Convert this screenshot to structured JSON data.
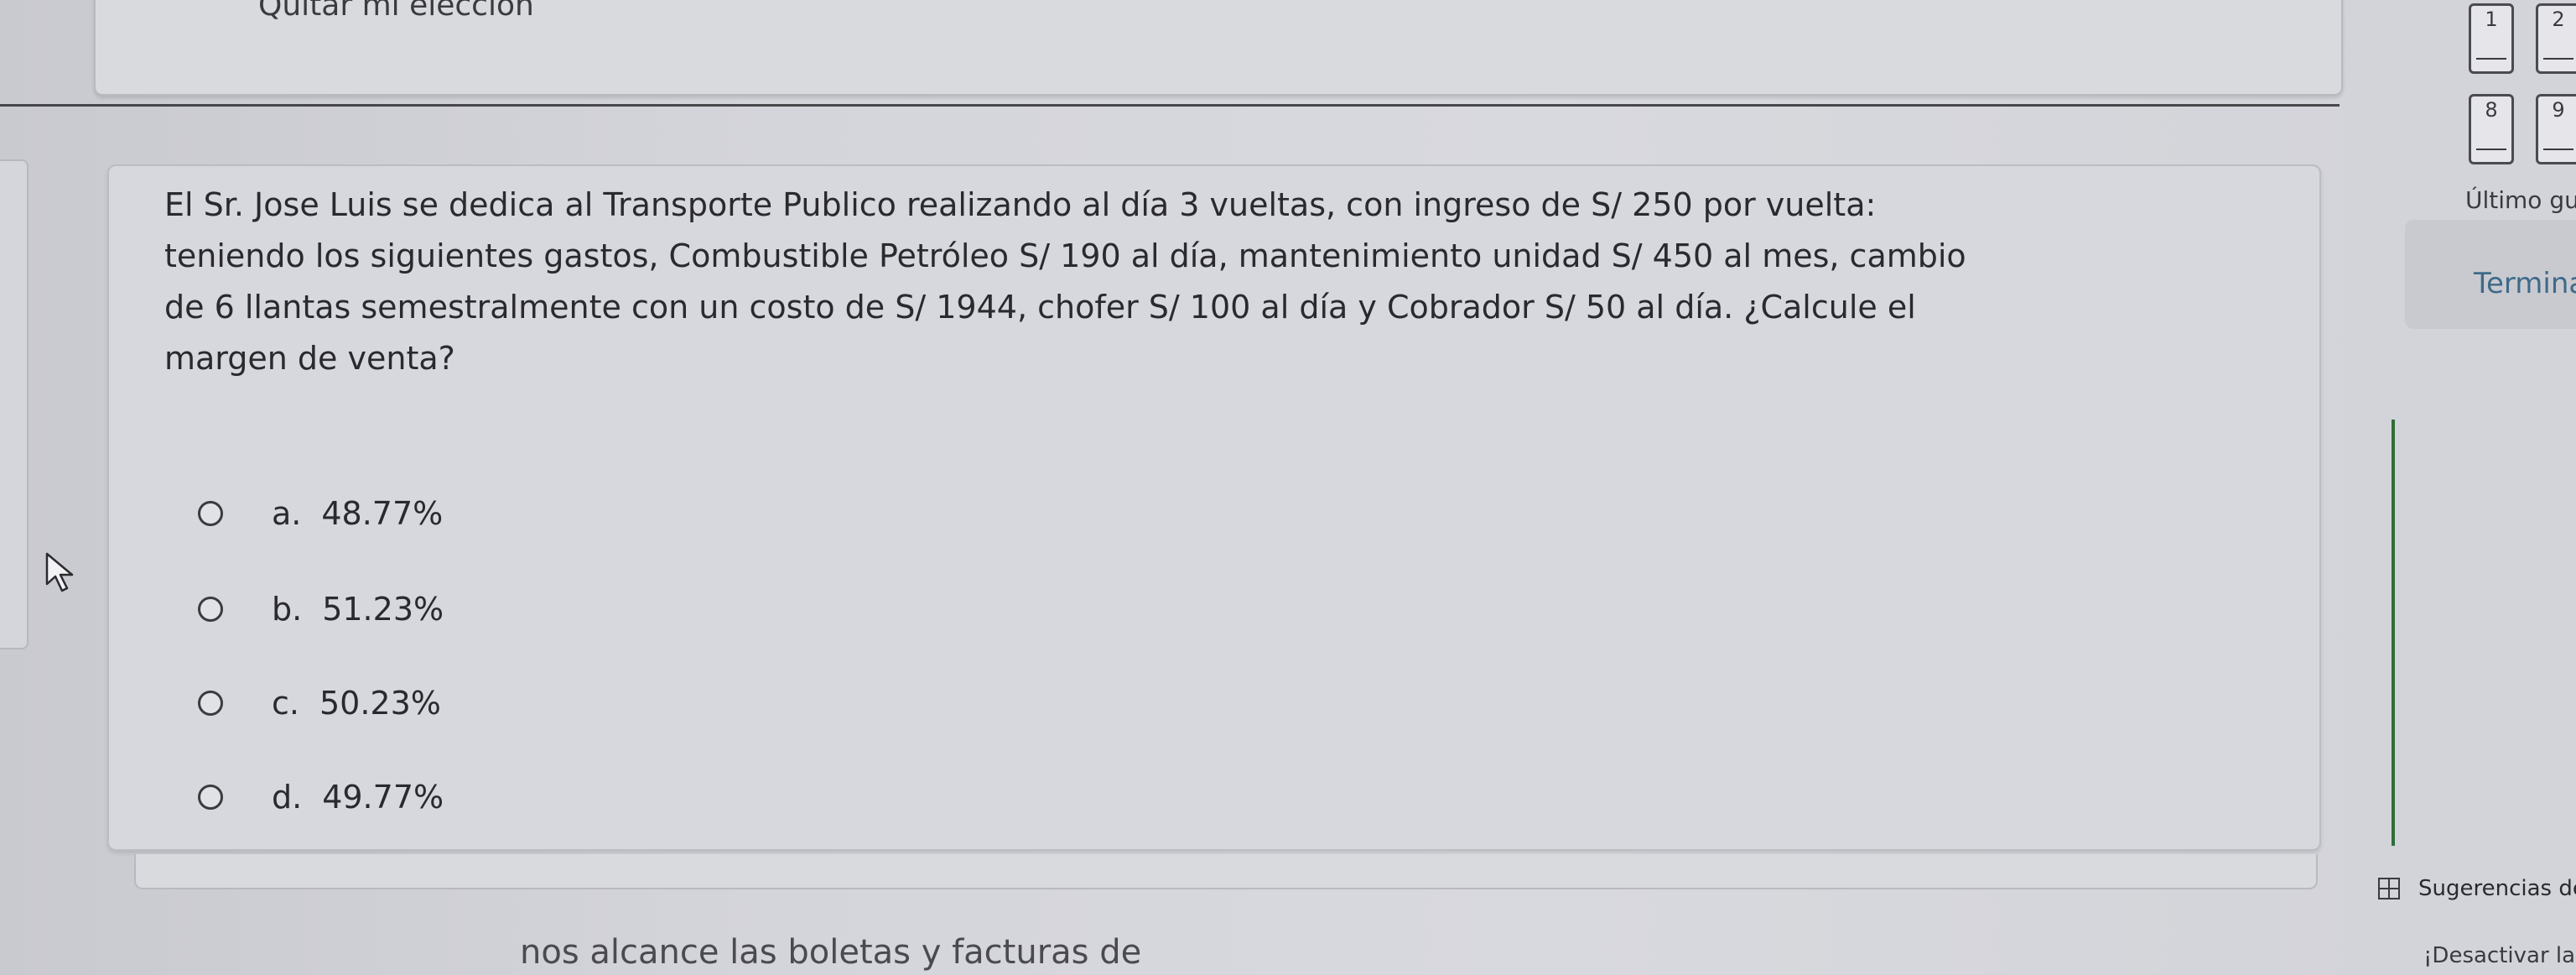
{
  "header": {
    "remove_choice": "Quitar mi elección"
  },
  "question": {
    "lines": [
      "El Sr. Jose Luis se dedica al Transporte Publico realizando al día 3 vueltas, con ingreso de S/ 250 por vuelta:",
      "teniendo los siguientes gastos, Combustible Petróleo S/ 190 al día, mantenimiento unidad S/ 450 al mes, cambio",
      "de 6 llantas semestralmente con un costo de S/ 1944, chofer S/ 100 al día y Cobrador S/ 50 al día. ¿Calcule el",
      "margen de venta?"
    ],
    "options": [
      {
        "letter": "a.",
        "value": "48.77%"
      },
      {
        "letter": "b.",
        "value": "51.23%"
      },
      {
        "letter": "c.",
        "value": "50.23%"
      },
      {
        "letter": "d.",
        "value": "49.77%"
      }
    ]
  },
  "footer": {
    "text": "nos alcance las boletas y facturas de"
  },
  "nav": {
    "boxes": [
      "1",
      "2",
      "8",
      "9"
    ],
    "last_saved": "Último gu",
    "finish": "Termina",
    "notifications_label": "Sugerencias de notif",
    "notifications_disable": "¡Desactivar las notifica"
  },
  "colors": {
    "background": "#cfd0d6",
    "card": "#d7d8dd",
    "link": "#3e6a8a",
    "accent_line": "#2e6e3a"
  }
}
